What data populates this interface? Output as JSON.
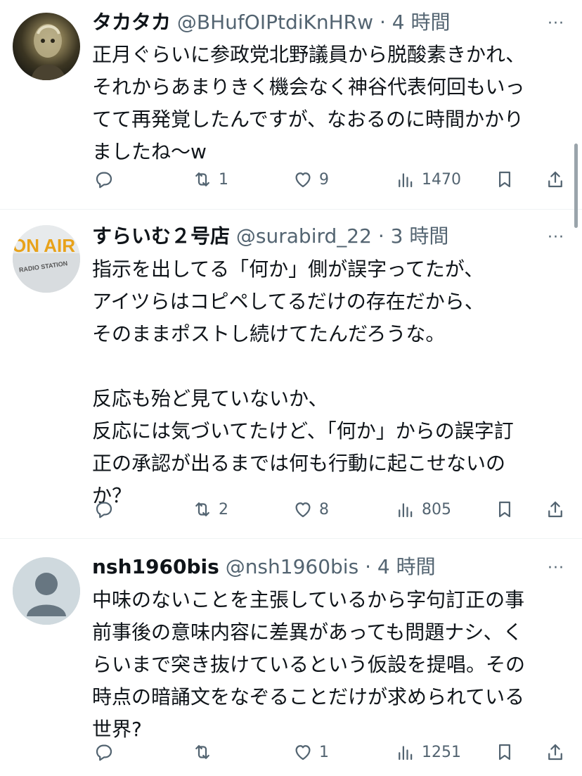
{
  "tweets": [
    {
      "name": "タカタカ",
      "handle": "@BHufOIPtdiKnHRw",
      "dot": "·",
      "time": "4 時間",
      "more": "···",
      "text": "正月ぐらいに参政党北野議員から脱酸素きかれ、\nそれからあまりきく機会なく神谷代表何回もいっ\nてて再発覚したんですが、なおるのに時間かかり\nましたね〜w",
      "reply_count": "",
      "retweet_count": "1",
      "like_count": "9",
      "view_count": "1470"
    },
    {
      "name": "すらいむ２号店",
      "handle": "@surabird_22",
      "dot": "·",
      "time": "3 時間",
      "more": "···",
      "text": "指示を出してる「何か」側が誤字ってたが、\nアイツらはコピペしてるだけの存在だから、\nそのままポストし続けてたんだろうな。\n\n反応も殆ど見ていないか、\n反応には気づいてたけど、「何か」からの誤字訂\n正の承認が出るまでは何も行動に起こせないの\nか？",
      "reply_count": "",
      "retweet_count": "2",
      "like_count": "8",
      "view_count": "805"
    },
    {
      "name": "nsh1960bis",
      "handle": "@nsh1960bis",
      "dot": "·",
      "time": "4 時間",
      "more": "···",
      "text": "中味のないことを主張しているから字句訂正の事\n前事後の意味内容に差異があっても問題ナシ、く\nらいまで突き抜けているという仮設を提唱。その\n時点の暗誦文をなぞることだけが求められている\n世界?",
      "reply_count": "",
      "retweet_count": "",
      "like_count": "1",
      "view_count": "1251"
    }
  ],
  "avatar2_text": "ON AIR",
  "avatar2_sub": "RADIO STATION",
  "icons": {
    "reply": "reply-icon",
    "retweet": "retweet-icon",
    "like": "heart-icon",
    "views": "views-icon",
    "bookmark": "bookmark-icon",
    "share": "share-icon"
  },
  "colors": {
    "text": "#0f1419",
    "secondary": "#536471",
    "divider": "#eff3f4"
  }
}
